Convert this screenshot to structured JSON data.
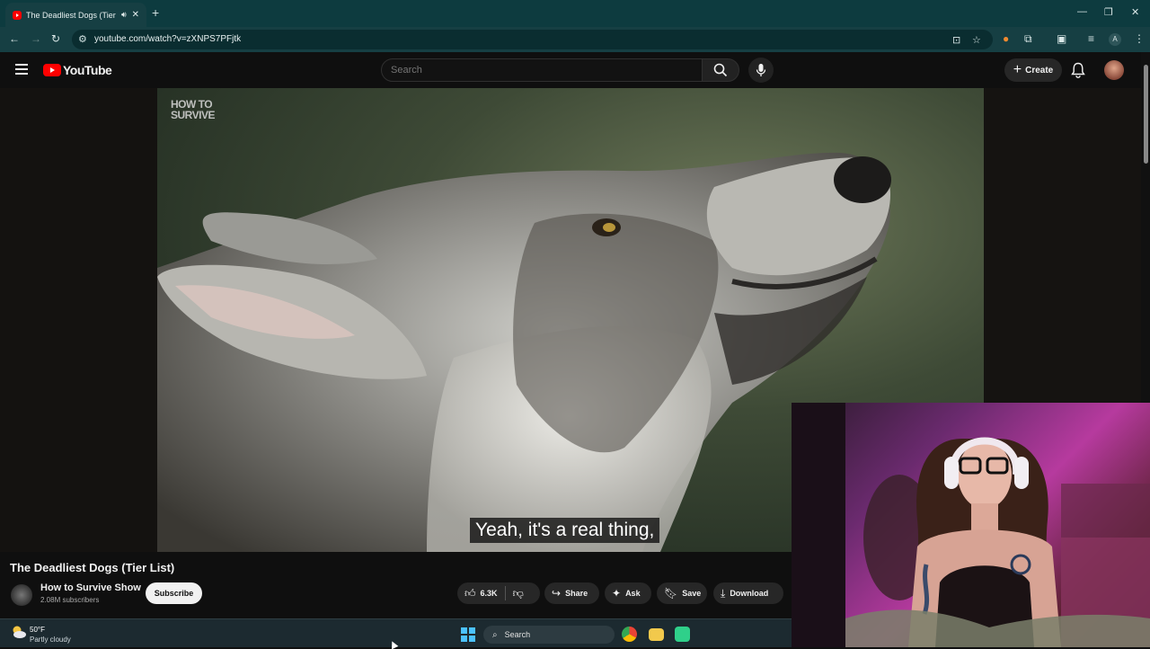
{
  "browser": {
    "tab_title": "The Deadliest Dogs (Tier Li",
    "url": "youtube.com/watch?v=zXNPS7PFjtk",
    "profile_initial": "A"
  },
  "youtube": {
    "logo_text": "YouTube",
    "search_placeholder": "Search",
    "create_label": "Create"
  },
  "video": {
    "watermark_line1": "HOW TO",
    "watermark_line2": "SURVIVE",
    "subtitle": "Yeah, it's a real thing,",
    "title": "The Deadliest Dogs (Tier List)"
  },
  "channel": {
    "name": "How to Survive Show",
    "subscribers": "2.08M subscribers",
    "subscribe_label": "Subscribe"
  },
  "actions": {
    "likes": "6.3K",
    "share": "Share",
    "ask": "Ask",
    "save": "Save",
    "download": "Download"
  },
  "taskbar": {
    "temperature": "50°F",
    "condition": "Partly cloudy",
    "search_label": "Search"
  },
  "colors": {
    "youtube_red": "#ff0000",
    "chrome_frame": "#0d3b3f",
    "yt_background": "#0f0f0f"
  }
}
